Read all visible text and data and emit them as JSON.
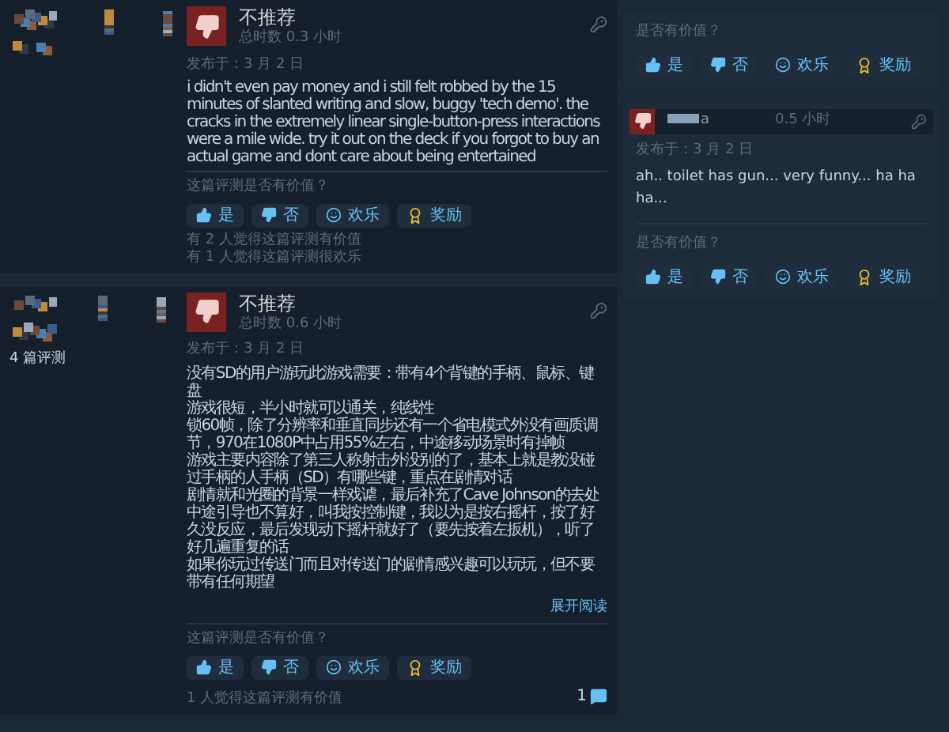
{
  "reviews": [
    {
      "verdict": "不推荐",
      "hours": "总时数 0.3 小时",
      "date": "发布于：3 月 2 日",
      "body": [
        "i didn't even pay money and i still felt robbed by the 15 minutes of slanted writing and slow, buggy 'tech demo'. the cracks in the extremely linear single-button-press interactions were a mile wide. try it out on the deck if you forgot to buy an actual game and dont care about being entertained"
      ],
      "question": "这篇评测是否有价值？",
      "buttons": [
        {
          "kind": "up",
          "label": "是"
        },
        {
          "kind": "down",
          "label": "否"
        },
        {
          "kind": "funny",
          "label": "欢乐"
        },
        {
          "kind": "award",
          "label": "奖励"
        }
      ],
      "stats": [
        "有 2 人觉得这篇评测有价值",
        "有 1 人觉得这篇评测很欢乐"
      ]
    },
    {
      "review_count": "4 篇评测",
      "verdict": "不推荐",
      "hours": "总时数 0.6 小时",
      "date": "发布于：3 月 2 日",
      "body": [
        "没有SD的用户游玩此游戏需要：带有4个背键的手柄、鼠标、键盘",
        "游戏很短，半小时就可以通关，纯线性",
        "锁60帧，除了分辨率和垂直同步还有一个省电模式外没有画质调节，970在1080P中占用55%左右，中途移动场景时有掉帧",
        "游戏主要内容除了第三人称射击外没别的了，基本上就是教没碰过手柄的人手柄（SD）有哪些键，重点在剧情对话",
        "剧情就和光圈的背景一样戏谑，最后补充了Cave Johnson的去处",
        "中途引导也不算好，叫我按控制键，我以为是按右摇杆，按了好久没反应，最后发现动下摇杆就好了（要先按着左扳机），听了好几遍重复的话",
        "如果你玩过传送门而且对传送门的剧情感兴趣可以玩玩，但不要带有任何期望"
      ],
      "expand": "展开阅读",
      "question": "这篇评测是否有价值？",
      "buttons": [
        {
          "kind": "up",
          "label": "是"
        },
        {
          "kind": "down",
          "label": "否"
        },
        {
          "kind": "funny",
          "label": "欢乐"
        },
        {
          "kind": "award",
          "label": "奖励"
        }
      ],
      "stats": [
        "1 人觉得这篇评测有价值"
      ],
      "comments": "1"
    }
  ],
  "side": {
    "question": "是否有价值？",
    "buttons": [
      {
        "kind": "up",
        "label": "是"
      },
      {
        "kind": "down",
        "label": "否"
      },
      {
        "kind": "funny",
        "label": "欢乐"
      },
      {
        "kind": "award",
        "label": "奖励"
      }
    ],
    "review": {
      "name": "a",
      "hours": "0.5 小时",
      "date": "发布于：3 月 2 日",
      "body": "ah.. toilet has gun... very funny... ha ha ha...",
      "question": "是否有价值？",
      "buttons": [
        {
          "kind": "up",
          "label": "是"
        },
        {
          "kind": "down",
          "label": "否"
        },
        {
          "kind": "funny",
          "label": "欢乐"
        },
        {
          "kind": "award",
          "label": "奖励"
        }
      ]
    }
  }
}
